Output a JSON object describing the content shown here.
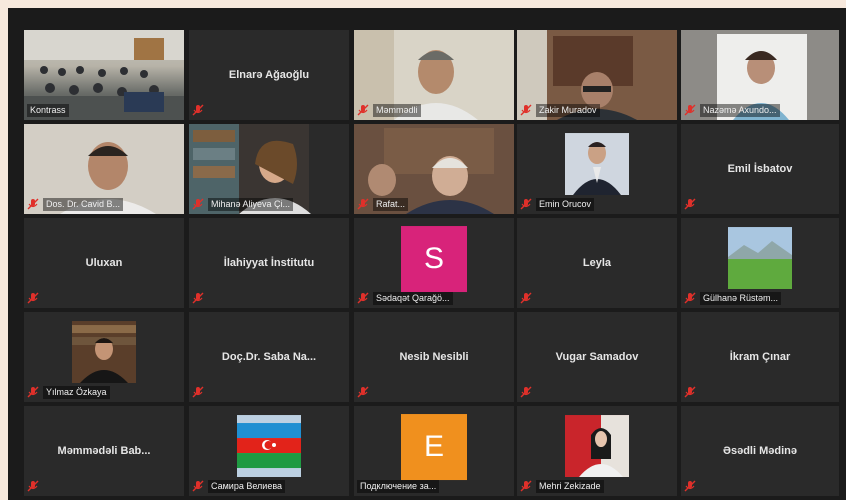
{
  "colors": {
    "accent_border": "#e7d23c",
    "mute_red": "#e0302a",
    "tile_bg": "#2a2a2a"
  },
  "tiles": {
    "t0": {
      "label": "Kontrass"
    },
    "t1": {
      "name": "Elnarə Ağaoğlu"
    },
    "t2": {
      "label": "Məmmədli"
    },
    "t3": {
      "label": "Zakir Muradov"
    },
    "t4": {
      "label": "Nazəmə Axundo..."
    },
    "t5": {
      "label": "Dos. Dr. Cavid B..."
    },
    "t6": {
      "label": "Mihanə Aliyeva Çi..."
    },
    "t7": {
      "label": "Rafat..."
    },
    "t8": {
      "label": "Emin Orucov"
    },
    "t9": {
      "name": "Emil İsbatov"
    },
    "t10": {
      "name": "Uluxan"
    },
    "t11": {
      "name": "İlahiyyat İnstitutu"
    },
    "t12": {
      "label": "Sədaqət Qarağö...",
      "avatar_letter": "S"
    },
    "t13": {
      "name": "Leyla"
    },
    "t14": {
      "label": "Gülhanə Rüstəm..."
    },
    "t15": {
      "label": "Yılmaz Özkaya"
    },
    "t16": {
      "name": "Doç.Dr. Saba Na..."
    },
    "t17": {
      "name": "Nesib Nesibli"
    },
    "t18": {
      "name": "Vugar Samadov"
    },
    "t19": {
      "name": "İkram Çınar"
    },
    "t20": {
      "name": "Məmmədəli Bab..."
    },
    "t21": {
      "label": "Самира Велиева"
    },
    "t22": {
      "label": "Подключение за...",
      "avatar_letter": "E"
    },
    "t23": {
      "label": "Mehri Zekizade"
    },
    "t24": {
      "name": "Əsədli Mədinə"
    }
  }
}
